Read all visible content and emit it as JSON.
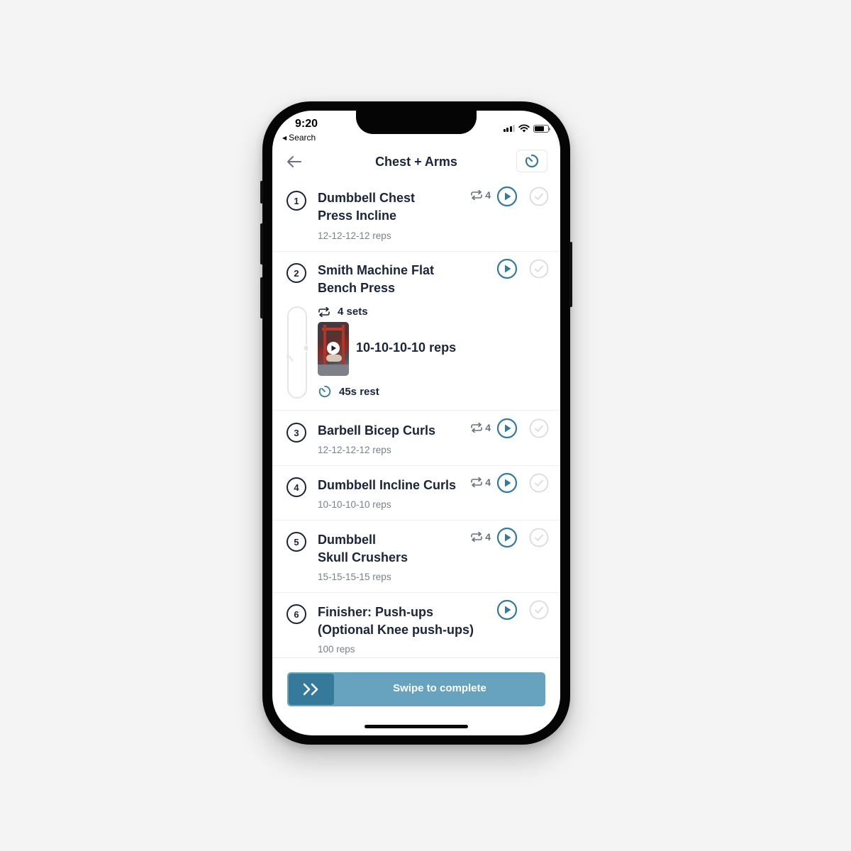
{
  "status_bar": {
    "time": "9:20",
    "back_label": "Search",
    "icons": [
      "cellular-signal-icon",
      "wifi-icon",
      "battery-icon"
    ]
  },
  "header": {
    "title": "Chest + Arms",
    "back_icon": "arrow-left-icon",
    "timer_icon": "timer-icon"
  },
  "exercises": [
    {
      "number": "1",
      "name_lines": [
        "Dumbbell Chest",
        "Press Incline"
      ],
      "sets": "4",
      "reps": "12-12-12-12 reps",
      "expanded": false
    },
    {
      "number": "2",
      "name_lines": [
        "Smith Machine Flat",
        "Bench Press"
      ],
      "sets_label": "4 sets",
      "reps": "10-10-10-10 reps",
      "rest": "45s rest",
      "expanded": true
    },
    {
      "number": "3",
      "name_lines": [
        "Barbell Bicep Curls"
      ],
      "sets": "4",
      "reps": "12-12-12-12 reps",
      "expanded": false
    },
    {
      "number": "4",
      "name_lines": [
        "Dumbbell Incline Curls"
      ],
      "sets": "4",
      "reps": "10-10-10-10 reps",
      "expanded": false
    },
    {
      "number": "5",
      "name_lines": [
        "Dumbbell",
        "Skull Crushers"
      ],
      "sets": "4",
      "reps": "15-15-15-15 reps",
      "expanded": false
    },
    {
      "number": "6",
      "name_lines": [
        "Finisher: Push-ups",
        "(Optional Knee push-ups)"
      ],
      "reps": "100 reps",
      "expanded": false
    }
  ],
  "footer": {
    "swipe_label": "Swipe to complete",
    "swipe_icon": "double-chevron-right-icon"
  },
  "colors": {
    "accent": "#367a9b",
    "swipe_track": "#67a2bf",
    "title_text": "#1b2438",
    "muted_text": "#7a7f88",
    "check_inactive": "#d9dbdf"
  }
}
